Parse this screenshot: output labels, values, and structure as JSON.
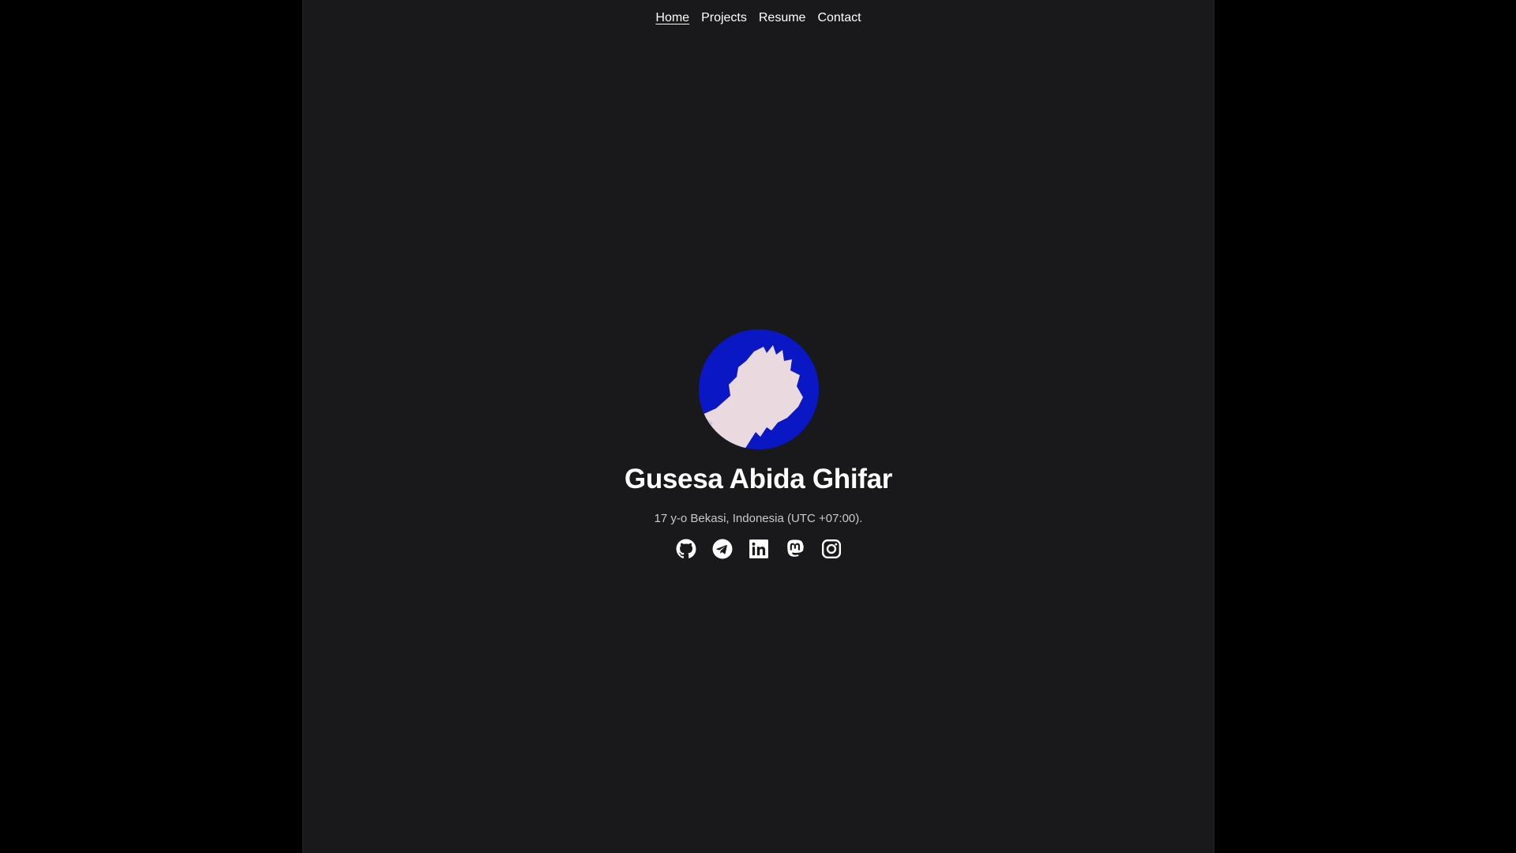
{
  "nav": {
    "items": [
      {
        "label": "Home",
        "active": true
      },
      {
        "label": "Projects",
        "active": false
      },
      {
        "label": "Resume",
        "active": false
      },
      {
        "label": "Contact",
        "active": false
      }
    ]
  },
  "profile": {
    "name": "Gusesa Abida Ghifar",
    "bio": "17 y-o Bekasi, Indonesia (UTC +07:00).",
    "avatar_colors": {
      "background": "#0a17c4",
      "figure": "#ead9df"
    }
  },
  "socials": [
    {
      "icon": "github-icon"
    },
    {
      "icon": "telegram-icon"
    },
    {
      "icon": "linkedin-icon"
    },
    {
      "icon": "mastodon-icon"
    },
    {
      "icon": "instagram-icon"
    }
  ],
  "colors": {
    "outer_background": "#000000",
    "page_background": "#19191b",
    "text": "#ffffff",
    "muted_text": "#c9c9cc"
  }
}
